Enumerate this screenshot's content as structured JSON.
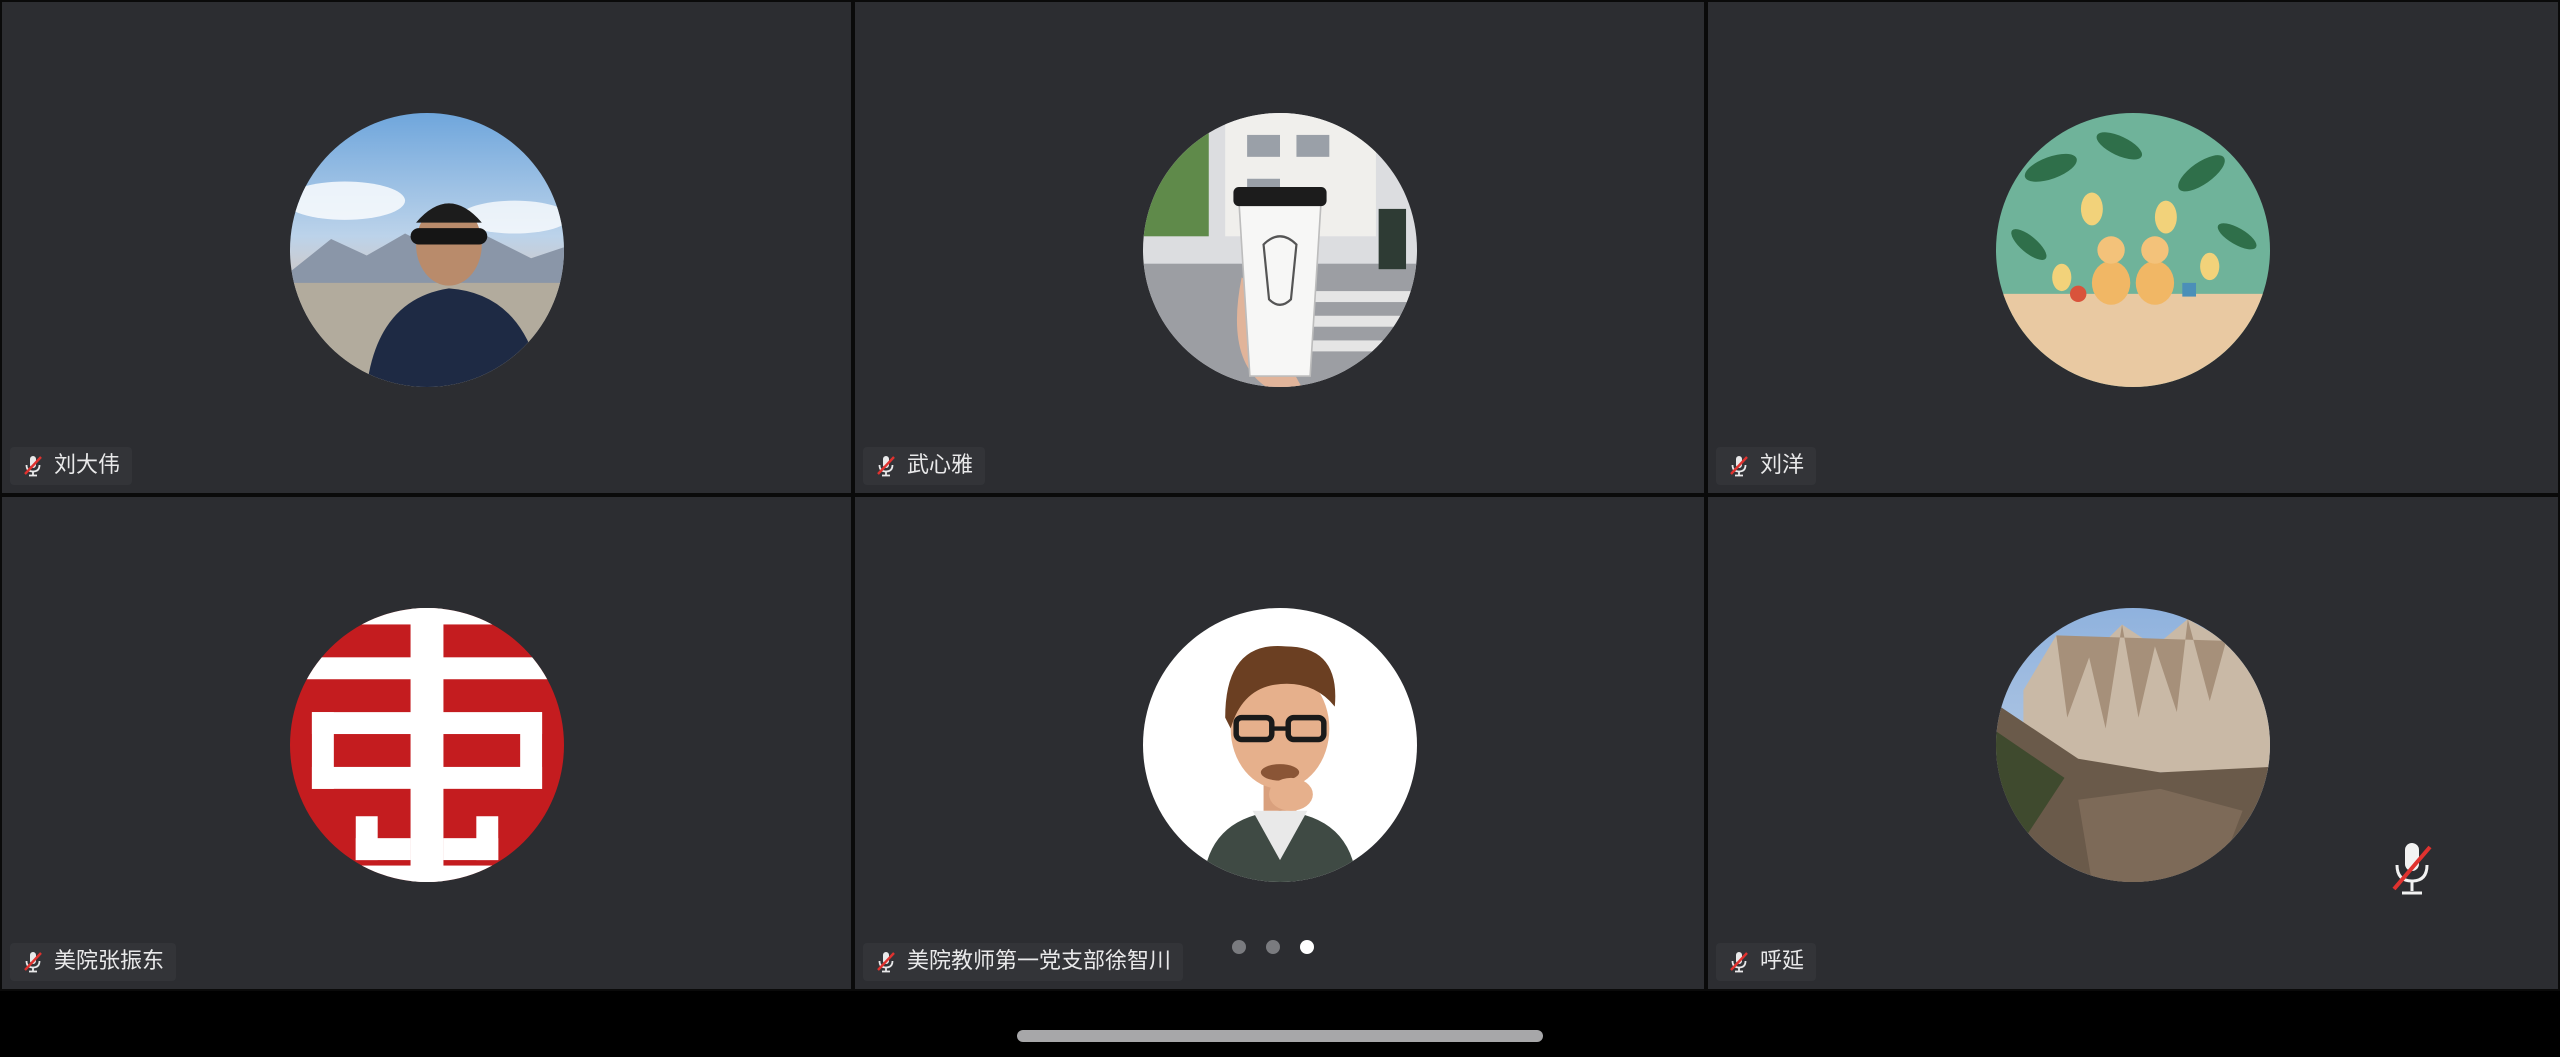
{
  "participants": [
    {
      "name": "刘大伟",
      "avatar": "man-with-sunglasses-photo",
      "muted": true
    },
    {
      "name": "武心雅",
      "avatar": "coffee-cup-street-photo",
      "muted": true
    },
    {
      "name": "刘洋",
      "avatar": "ducks-under-leaves-illustration",
      "muted": true
    },
    {
      "name": "美院张振东",
      "avatar": "red-seal-character-logo",
      "muted": true
    },
    {
      "name": "美院教师第一党支部徐智川",
      "avatar": "cartoon-man-with-glasses-avatar",
      "muted": true
    },
    {
      "name": "呼延",
      "avatar": "mountain-cliff-photo",
      "muted": true
    }
  ],
  "pagination": {
    "pages": 3,
    "current": 3
  },
  "icons": {
    "muted_mic": "mic-muted-icon",
    "large_mic": "mic-muted-large-icon"
  },
  "colors": {
    "tile_bg": "#2c2d31",
    "muted_slash": "#e0322f",
    "nametag_text": "#e9e9ea"
  }
}
